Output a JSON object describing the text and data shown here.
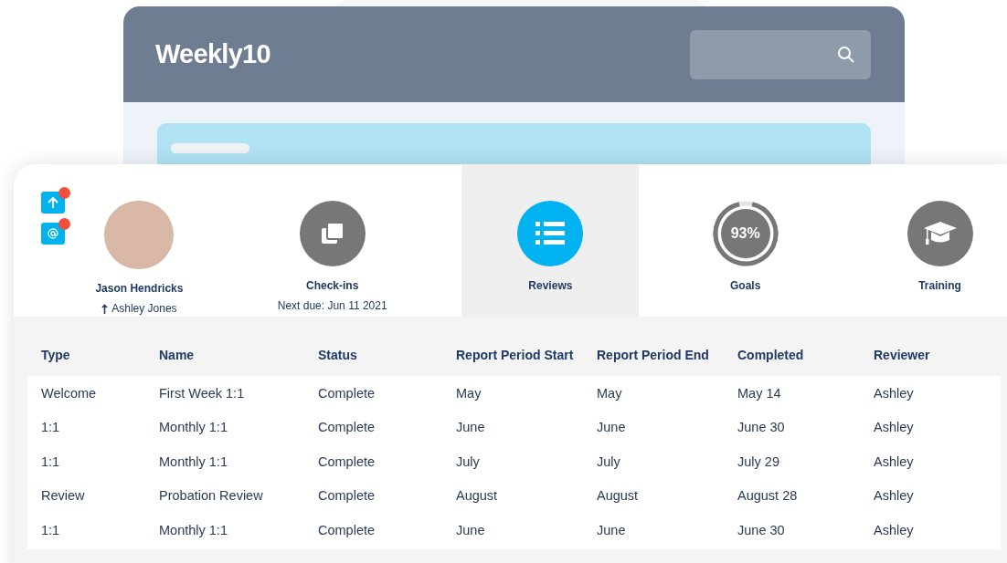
{
  "app": {
    "logo": "Weekly10"
  },
  "notifications": [
    {
      "kind": "upload",
      "unread": true
    },
    {
      "kind": "mention",
      "unread": true
    }
  ],
  "tabs": [
    {
      "kind": "person",
      "label": "Jason Hendricks",
      "sub": "Ashley Jones",
      "selected": false
    },
    {
      "kind": "checkins",
      "label": "Check-ins",
      "sub": "Next due: Jun 11 2021",
      "selected": false
    },
    {
      "kind": "reviews",
      "label": "Reviews",
      "selected": true
    },
    {
      "kind": "goals",
      "label": "Goals",
      "ring_text": "93%",
      "level": 0.93,
      "selected": false
    },
    {
      "kind": "training",
      "label": "Training",
      "selected": false
    }
  ],
  "table": {
    "columns": [
      "Type",
      "Name",
      "Status",
      "Report Period Start",
      "Report Period End",
      "Completed",
      "Reviewer"
    ],
    "rows": [
      [
        "Welcome",
        "First Week 1:1",
        "Complete",
        "May",
        "May",
        "May 14",
        "Ashley"
      ],
      [
        "1:1",
        "Monthly 1:1",
        "Complete",
        "June",
        "June",
        "June 30",
        "Ashley"
      ],
      [
        "1:1",
        "Monthly 1:1",
        "Complete",
        "July",
        "July",
        "July 29",
        "Ashley"
      ],
      [
        "Review",
        "Probation Review",
        "Complete",
        "August",
        "August",
        "August 28",
        "Ashley"
      ],
      [
        "1:1",
        "Monthly 1:1",
        "Complete",
        "June",
        "June",
        "June 30",
        "Ashley"
      ]
    ]
  }
}
